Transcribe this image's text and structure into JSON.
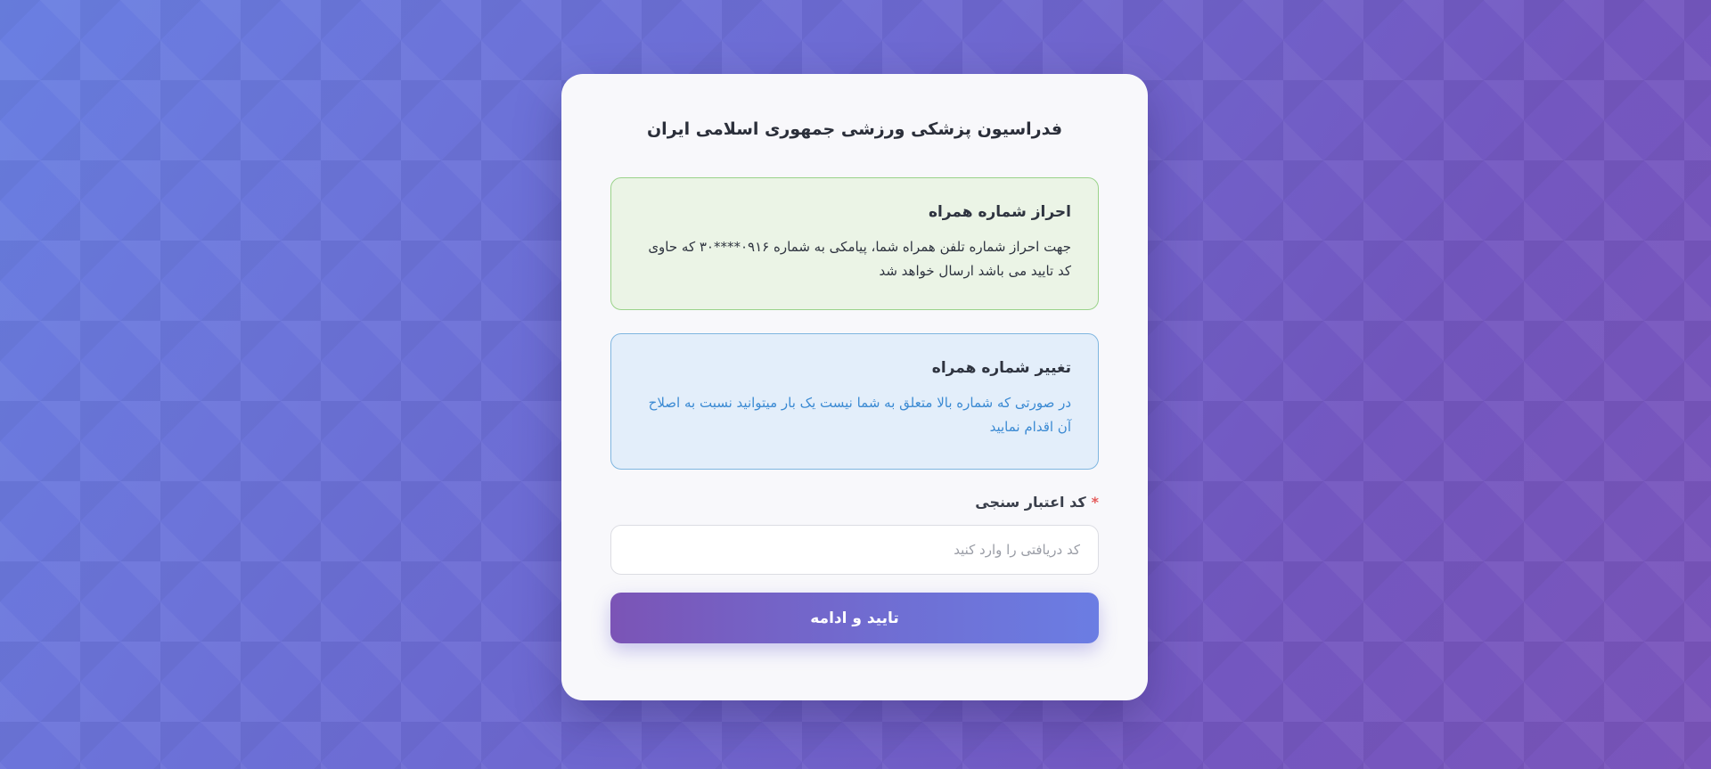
{
  "header": {
    "title": "فدراسیون پزشکی ورزشی جمهوری اسلامی ایران"
  },
  "verify_alert": {
    "title": "احراز شماره همراه",
    "text": "جهت احراز شماره تلفن همراه شما، پیامکی به شماره ۰۹۱۶****۳۰ که حاوی کد تایید می باشد ارسال خواهد شد"
  },
  "change_alert": {
    "title": "تغییر شماره همراه",
    "text": "در صورتی که شماره بالا متعلق به شما نیست یک بار میتوانید نسبت به اصلاح آن اقدام نمایید"
  },
  "code_field": {
    "required_mark": "*",
    "label": "کد اعتبار سنجی",
    "value": "",
    "placeholder": "کد دریافتی را وارد کنید"
  },
  "submit": {
    "label": "تایید و ادامه"
  },
  "colors": {
    "success_bg": "#ebf4e6",
    "success_border": "#9ad38a",
    "info_bg": "#e3eefa",
    "info_border": "#7fb6e0",
    "info_text": "#3b8ad3",
    "button_start": "#6b7de3",
    "button_end": "#7b54b6"
  }
}
